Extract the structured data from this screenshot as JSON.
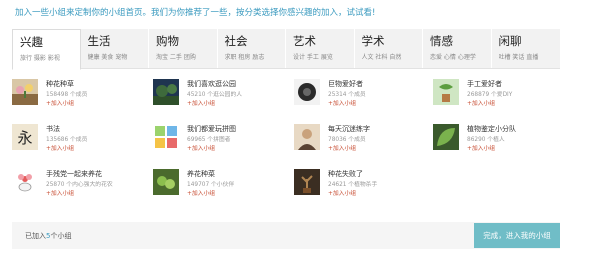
{
  "intro_text": "加入一些小组来定制你的小组首页。我们为你推荐了一些，按分类选择你感兴趣的加入，试试看!",
  "tabs": [
    {
      "name": "兴趣",
      "sub": "旅行 摄影 影视",
      "active": true
    },
    {
      "name": "生活",
      "sub": "健康 美食 宠物",
      "active": false
    },
    {
      "name": "购物",
      "sub": "淘宝 二手 团购",
      "active": false
    },
    {
      "name": "社会",
      "sub": "求职 租房 励志",
      "active": false
    },
    {
      "name": "艺术",
      "sub": "设计 手工 展览",
      "active": false
    },
    {
      "name": "学术",
      "sub": "人文 社科 自然",
      "active": false
    },
    {
      "name": "情感",
      "sub": "恋爱 心情 心理学",
      "active": false
    },
    {
      "name": "闲聊",
      "sub": "吐槽 笑话 直播",
      "active": false
    }
  ],
  "groups": [
    {
      "name": "种花种草",
      "count": "158498 个成员",
      "join": "+加入小组",
      "icon": "flowers-thumbnail"
    },
    {
      "name": "我们喜欢逛公园",
      "count": "45210 个逛公园的人",
      "join": "+加入小组",
      "icon": "park-thumbnail"
    },
    {
      "name": "巨物爱好者",
      "count": "25314 个成员",
      "join": "+加入小组",
      "icon": "giant-object-thumbnail"
    },
    {
      "name": "手工爱好者",
      "count": "268879 个爱DIY",
      "join": "+加入小组",
      "icon": "plant-pot-thumbnail"
    },
    {
      "name": "书法",
      "count": "135686 个成员",
      "join": "+加入小组",
      "icon": "calligraphy-thumbnail"
    },
    {
      "name": "我们都爱玩拼图",
      "count": "69965 个拼图者",
      "join": "+加入小组",
      "icon": "puzzle-thumbnail"
    },
    {
      "name": "每天沉迷练字",
      "count": "78036 个成员",
      "join": "+加入小组",
      "icon": "portrait-thumbnail"
    },
    {
      "name": "植物鉴定小分队",
      "count": "86290 个植人",
      "join": "+加入小组",
      "icon": "leaf-thumbnail"
    },
    {
      "name": "手残党一起来养花",
      "count": "25870 个内心强大的花农",
      "join": "+加入小组",
      "icon": "cartoon-flower-thumbnail"
    },
    {
      "name": "养花种菜",
      "count": "149707 个小伙伴",
      "join": "+加入小组",
      "icon": "vegetables-thumbnail"
    },
    {
      "name": "种花失败了",
      "count": "24621 个植物杀手",
      "join": "+加入小组",
      "icon": "dead-plant-thumbnail"
    }
  ],
  "footer": {
    "prefix": "已加入",
    "count": "5",
    "suffix": "个小组",
    "done_label": "完成，进入我的小组"
  }
}
